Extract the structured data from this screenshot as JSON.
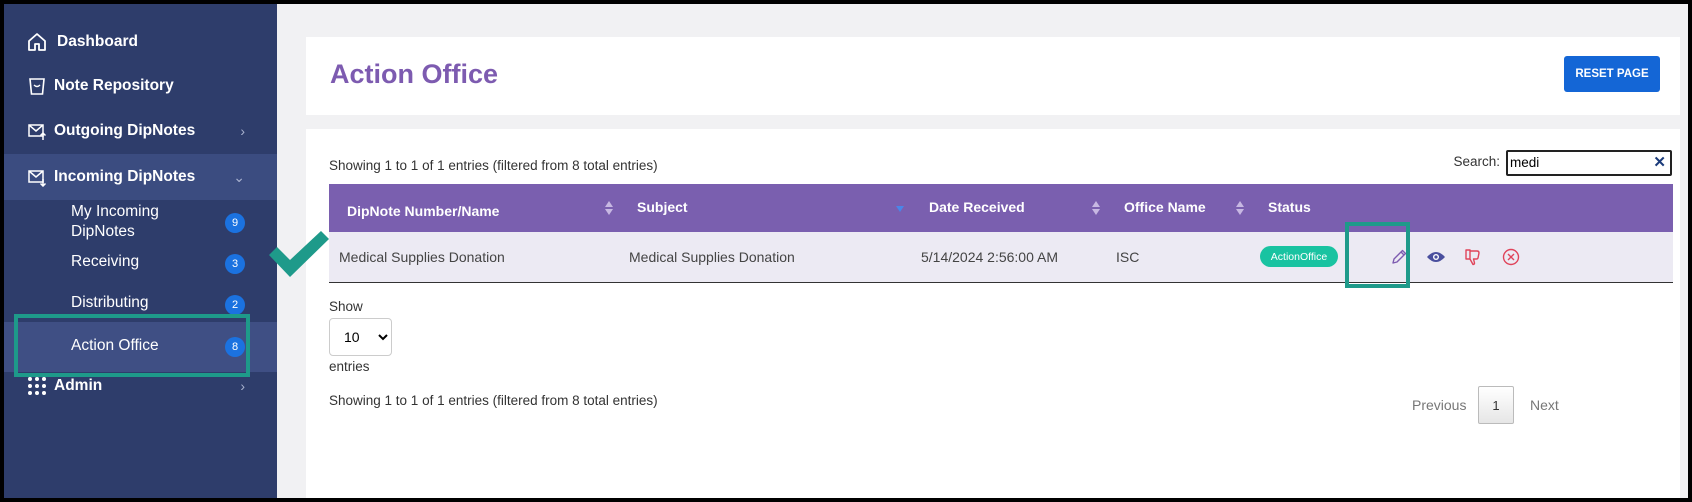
{
  "sidebar": {
    "items": [
      {
        "label": "Dashboard",
        "icon": "home-icon"
      },
      {
        "label": "Note Repository",
        "icon": "trash-icon"
      },
      {
        "label": "Outgoing DipNotes",
        "icon": "mail-out-icon"
      },
      {
        "label": "Incoming DipNotes",
        "icon": "mail-in-icon"
      },
      {
        "label": "Admin",
        "icon": "grid-icon"
      }
    ],
    "subitems": [
      {
        "label_line1": "My Incoming",
        "label_line2": "DipNotes",
        "count": "9"
      },
      {
        "label": "Receiving",
        "count": "3"
      },
      {
        "label": "Distributing",
        "count": "2"
      },
      {
        "label": "Action Office",
        "count": "8"
      }
    ]
  },
  "header": {
    "title": "Action Office",
    "reset_label": "RESET PAGE"
  },
  "table": {
    "info_top": "Showing 1 to 1 of 1 entries (filtered from 8 total entries)",
    "search_label": "Search:",
    "search_value": "medi",
    "columns": [
      "DipNote Number/Name",
      "Subject",
      "Date Received",
      "Office Name",
      "Status"
    ],
    "rows": [
      {
        "name": "Medical Supplies Donation",
        "subject": "Medical Supplies Donation",
        "date": "5/14/2024 2:56:00 AM",
        "office": "ISC",
        "status": "ActionOffice"
      }
    ],
    "show_label": "Show",
    "page_length": "10",
    "entries_label": "entries",
    "info_bottom": "Showing 1 to 1 of 1 entries (filtered from 8 total entries)",
    "pagination": {
      "previous": "Previous",
      "current": "1",
      "next": "Next"
    }
  },
  "colors": {
    "sidebar": "#2e3d6b",
    "header": "#7a5faf",
    "accent": "#1466d6",
    "status": "#19c3a1",
    "highlight": "#1e9a8a"
  }
}
